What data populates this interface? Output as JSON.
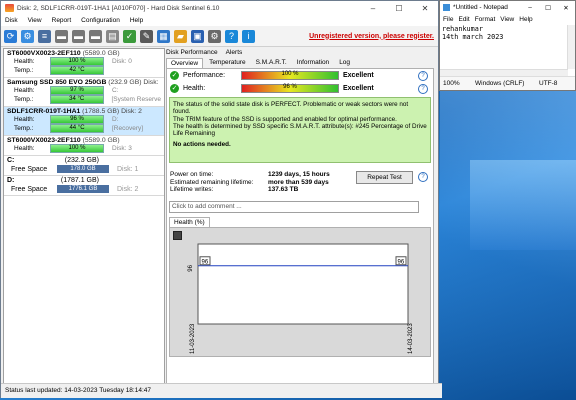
{
  "hds": {
    "title": "Disk: 2, SDLF1CRR-019T-1HA1 [A010F070]  -  Hard Disk Sentinel 6.10",
    "window_buttons": [
      "–",
      "☐",
      "✕"
    ],
    "menu": [
      "Disk",
      "View",
      "Report",
      "Configuration",
      "Help"
    ],
    "unregistered": "Unregistered version, please register.",
    "disks": [
      {
        "name": "ST6000VX0023-2EF110",
        "cap": "(5589.0 GB)",
        "health_label": "Health:",
        "health": "100 %",
        "health_pct": 100,
        "health_extra": "Disk: 0",
        "temp_label": "Temp.:",
        "temp": "42 °C",
        "temp_extra": ""
      },
      {
        "name": "Samsung SSD 850 EVO 250GB",
        "cap": "(232.9 GB) Disk:",
        "health_label": "Health:",
        "health": "97 %",
        "health_pct": 97,
        "health_extra": "C:",
        "temp_label": "Temp.:",
        "temp": "34 °C",
        "temp_extra": "[System Reserve"
      },
      {
        "name": "SDLF1CRR-019T-1HA1",
        "cap": "(1788.5 GB) Disk: 2",
        "health_label": "Health:",
        "health": "96 %",
        "health_pct": 96,
        "health_extra": "D:",
        "temp_label": "Temp.:",
        "temp": "44 °C",
        "temp_extra": "[Recovery]"
      },
      {
        "name": "ST6000VX0023-2EF110",
        "cap": "(5589.0 GB)",
        "health_label": "Health:",
        "health": "100 %",
        "health_pct": 100,
        "health_extra": "Disk: 3",
        "temp_label": "",
        "temp": "",
        "temp_extra": ""
      }
    ],
    "volumes": [
      {
        "name": "C:",
        "size": "(232.3 GB)",
        "free_label": "Free Space",
        "free": "178.0 GB",
        "disk": "Disk: 1"
      },
      {
        "name": "D:",
        "size": "(1787.1 GB)",
        "free_label": "Free Space",
        "free": "1776.1 GB",
        "disk": "Disk: 2"
      }
    ],
    "tabs_top": [
      "Disk Performance",
      "Alerts"
    ],
    "tabs": [
      "Overview",
      "Temperature",
      "S.M.A.R.T.",
      "Information",
      "Log"
    ],
    "performance": {
      "label": "Performance:",
      "value": "100 %",
      "pct": 100,
      "rating": "Excellent"
    },
    "health": {
      "label": "Health:",
      "value": "96 %",
      "pct": 96,
      "rating": "Excellent"
    },
    "status_lines": [
      "The status of the solid state disk is PERFECT. Problematic or weak sectors were not found.",
      "The TRIM feature of the SSD is supported and enabled for optimal performance.",
      "The health is determined by SSD specific S.M.A.R.T. attribute(s):  #245 Percentage of Drive Life Remaining"
    ],
    "no_actions": "No actions needed.",
    "stats": [
      {
        "k": "Power on time:",
        "v": "1239 days, 15 hours"
      },
      {
        "k": "Estimated remaining lifetime:",
        "v": "more than 539 days"
      },
      {
        "k": "Lifetime writes:",
        "v": "137.63 TB"
      }
    ],
    "repeat_test": "Repeat Test",
    "comment_placeholder": "Click to add comment ...",
    "health_tab": "Health (%)",
    "statusbar": "Status last updated: 14-03-2023 Tuesday 18:14:47"
  },
  "chart_data": {
    "type": "line",
    "x": [
      "11-03-2023",
      "14-03-2023"
    ],
    "series": [
      {
        "values": [
          96,
          96
        ]
      }
    ],
    "ylabel": "96",
    "data_labels": [
      "96",
      "96"
    ]
  },
  "notepad": {
    "title": "*Untitled - Notepad",
    "menu": [
      "File",
      "Edit",
      "Format",
      "View",
      "Help"
    ],
    "lines": [
      "rehankumar",
      "14th march 2023"
    ],
    "status": [
      "100%",
      "Windows (CRLF)",
      "UTF-8"
    ]
  }
}
